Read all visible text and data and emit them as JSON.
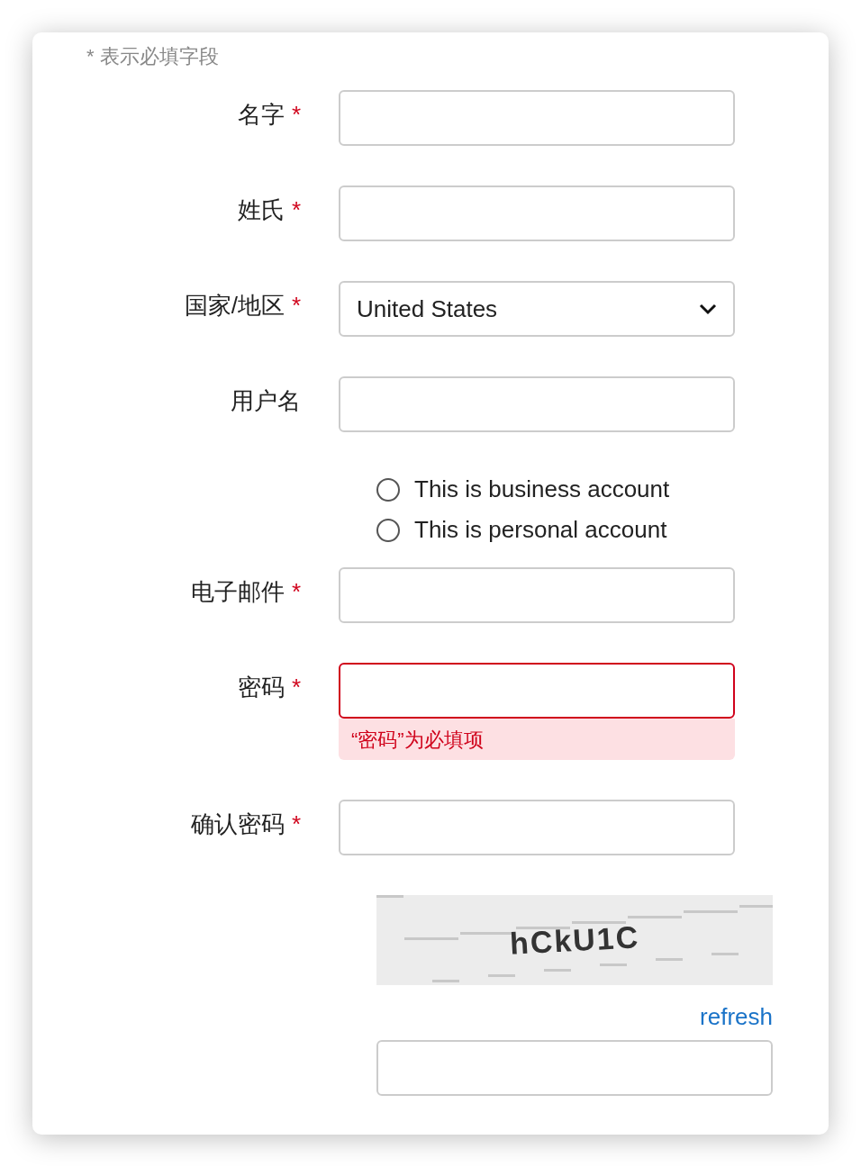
{
  "required_note": "* 表示必填字段",
  "fields": [
    {
      "kind": "text",
      "label": "名字",
      "required_mark": "*"
    },
    {
      "kind": "text",
      "label": "姓氏",
      "required_mark": "*"
    },
    {
      "kind": "select",
      "label": "国家/地区",
      "required_mark": "*",
      "value": "United States"
    },
    {
      "kind": "text",
      "label": "用户名"
    },
    {
      "kind": "radios",
      "options": [
        {
          "label": "This is business account",
          "selected": false
        },
        {
          "label": "This is personal account",
          "selected": false
        }
      ]
    },
    {
      "kind": "text",
      "label": "电子邮件",
      "required_mark": "*"
    },
    {
      "kind": "text",
      "label": "密码",
      "required_mark": "*",
      "error": "“密码”为必填项"
    },
    {
      "kind": "text",
      "label": "确认密码",
      "required_mark": "*"
    },
    {
      "kind": "captcha",
      "text": "hCkU1C",
      "link": "refresh"
    }
  ]
}
